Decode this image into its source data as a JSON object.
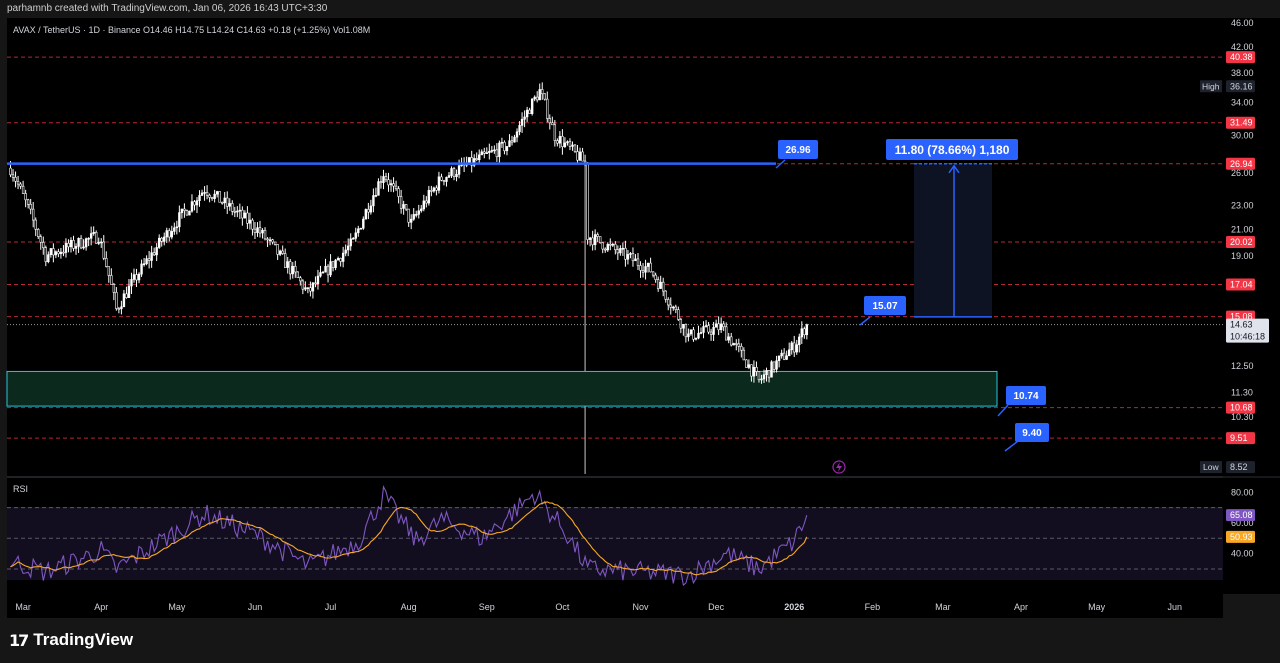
{
  "header": {
    "attribution": "parhamnb created with TradingView.com, Jan 06, 2026 16:43 UTC+3:30",
    "symbol_line": "AVAX / TetherUS · 1D · Binance  O14.46  H14.75  L14.24  C14.63  +0.18 (+1.25%)  Vol1.08M"
  },
  "footer": {
    "logo_mark": "17",
    "brand": "TradingView"
  },
  "colors": {
    "background": "#000000",
    "up": "#ffffff",
    "down": "#000000",
    "resistance_line": "#2962ff",
    "level_line": "#f23645",
    "zone_fill": "#0b2a1d",
    "zone_border": "#26c6da",
    "rsi_line": "#7e57c2",
    "rsi_ma": "#f9a825",
    "target_box": "#0d1322",
    "label_bg": "#2962ff"
  },
  "chart_data": [
    {
      "type": "candlestick",
      "title": "AVAX / TetherUS · 1D · Binance",
      "ohlc_last": {
        "open": 14.46,
        "high": 14.75,
        "low": 14.24,
        "close": 14.63,
        "change": "+0.18 (+1.25%)",
        "volume": "1.08M"
      },
      "y_scale": "log",
      "ylim": [
        8.3,
        46.5
      ],
      "y_ticks": [
        "46.00",
        "42.00",
        "38.00",
        "34.00",
        "30.00",
        "26.00",
        "23.00",
        "21.00",
        "19.00",
        "17.00",
        "15.00",
        "12.50",
        "11.30",
        "10.30",
        "9.51",
        "8.52"
      ],
      "x_ticks": [
        "Mar",
        "Apr",
        "May",
        "Jun",
        "Jul",
        "Aug",
        "Sep",
        "Oct",
        "Nov",
        "Dec",
        "2026",
        "Feb",
        "Mar",
        "Apr",
        "May",
        "Jun"
      ],
      "price_series_approx": [
        {
          "x": "2025-02-24",
          "y": 26.5
        },
        {
          "x": "2025-03-10",
          "y": 19.0
        },
        {
          "x": "2025-03-31",
          "y": 20.5
        },
        {
          "x": "2025-04-07",
          "y": 15.5
        },
        {
          "x": "2025-05-12",
          "y": 24.5
        },
        {
          "x": "2025-06-02",
          "y": 21.0
        },
        {
          "x": "2025-06-22",
          "y": 16.5
        },
        {
          "x": "2025-07-10",
          "y": 20.0
        },
        {
          "x": "2025-07-22",
          "y": 26.0
        },
        {
          "x": "2025-08-02",
          "y": 21.5
        },
        {
          "x": "2025-08-14",
          "y": 25.5
        },
        {
          "x": "2025-09-10",
          "y": 29.0
        },
        {
          "x": "2025-09-22",
          "y": 35.5
        },
        {
          "x": "2025-09-28",
          "y": 30.0
        },
        {
          "x": "2025-10-10",
          "y": 27.0
        },
        {
          "x": "2025-10-11",
          "y": 20.5
        },
        {
          "x": "2025-11-05",
          "y": 18.0
        },
        {
          "x": "2025-11-20",
          "y": 14.0
        },
        {
          "x": "2025-12-03",
          "y": 14.5
        },
        {
          "x": "2025-12-18",
          "y": 11.8
        },
        {
          "x": "2026-01-01",
          "y": 13.5
        },
        {
          "x": "2026-01-06",
          "y": 14.63
        }
      ],
      "levels": [
        40.38,
        31.49,
        26.94,
        20.02,
        17.04,
        15.08,
        10.68,
        9.51
      ],
      "high_label": "High",
      "high": 36.16,
      "low_label": "Low",
      "low": 8.52,
      "current_price": 14.63,
      "countdown": "10:46:18",
      "annotations": {
        "resistance": "26.96",
        "current_callout": "15.07",
        "zone_label": "10.74",
        "support_callout": "9.40",
        "target": "11.80 (78.66%) 1,180"
      },
      "demand_zone": [
        10.74,
        12.25
      ],
      "target_range": [
        15.07,
        26.94
      ]
    },
    {
      "type": "line",
      "title": "RSI",
      "ylim": [
        15,
        88
      ],
      "y_ticks": [
        "80.00",
        "60.00",
        "40.00"
      ],
      "bands": [
        70,
        50,
        30
      ],
      "series": [
        {
          "name": "RSI",
          "value": 65.08
        },
        {
          "name": "RSI MA",
          "value": 50.93
        }
      ]
    }
  ]
}
